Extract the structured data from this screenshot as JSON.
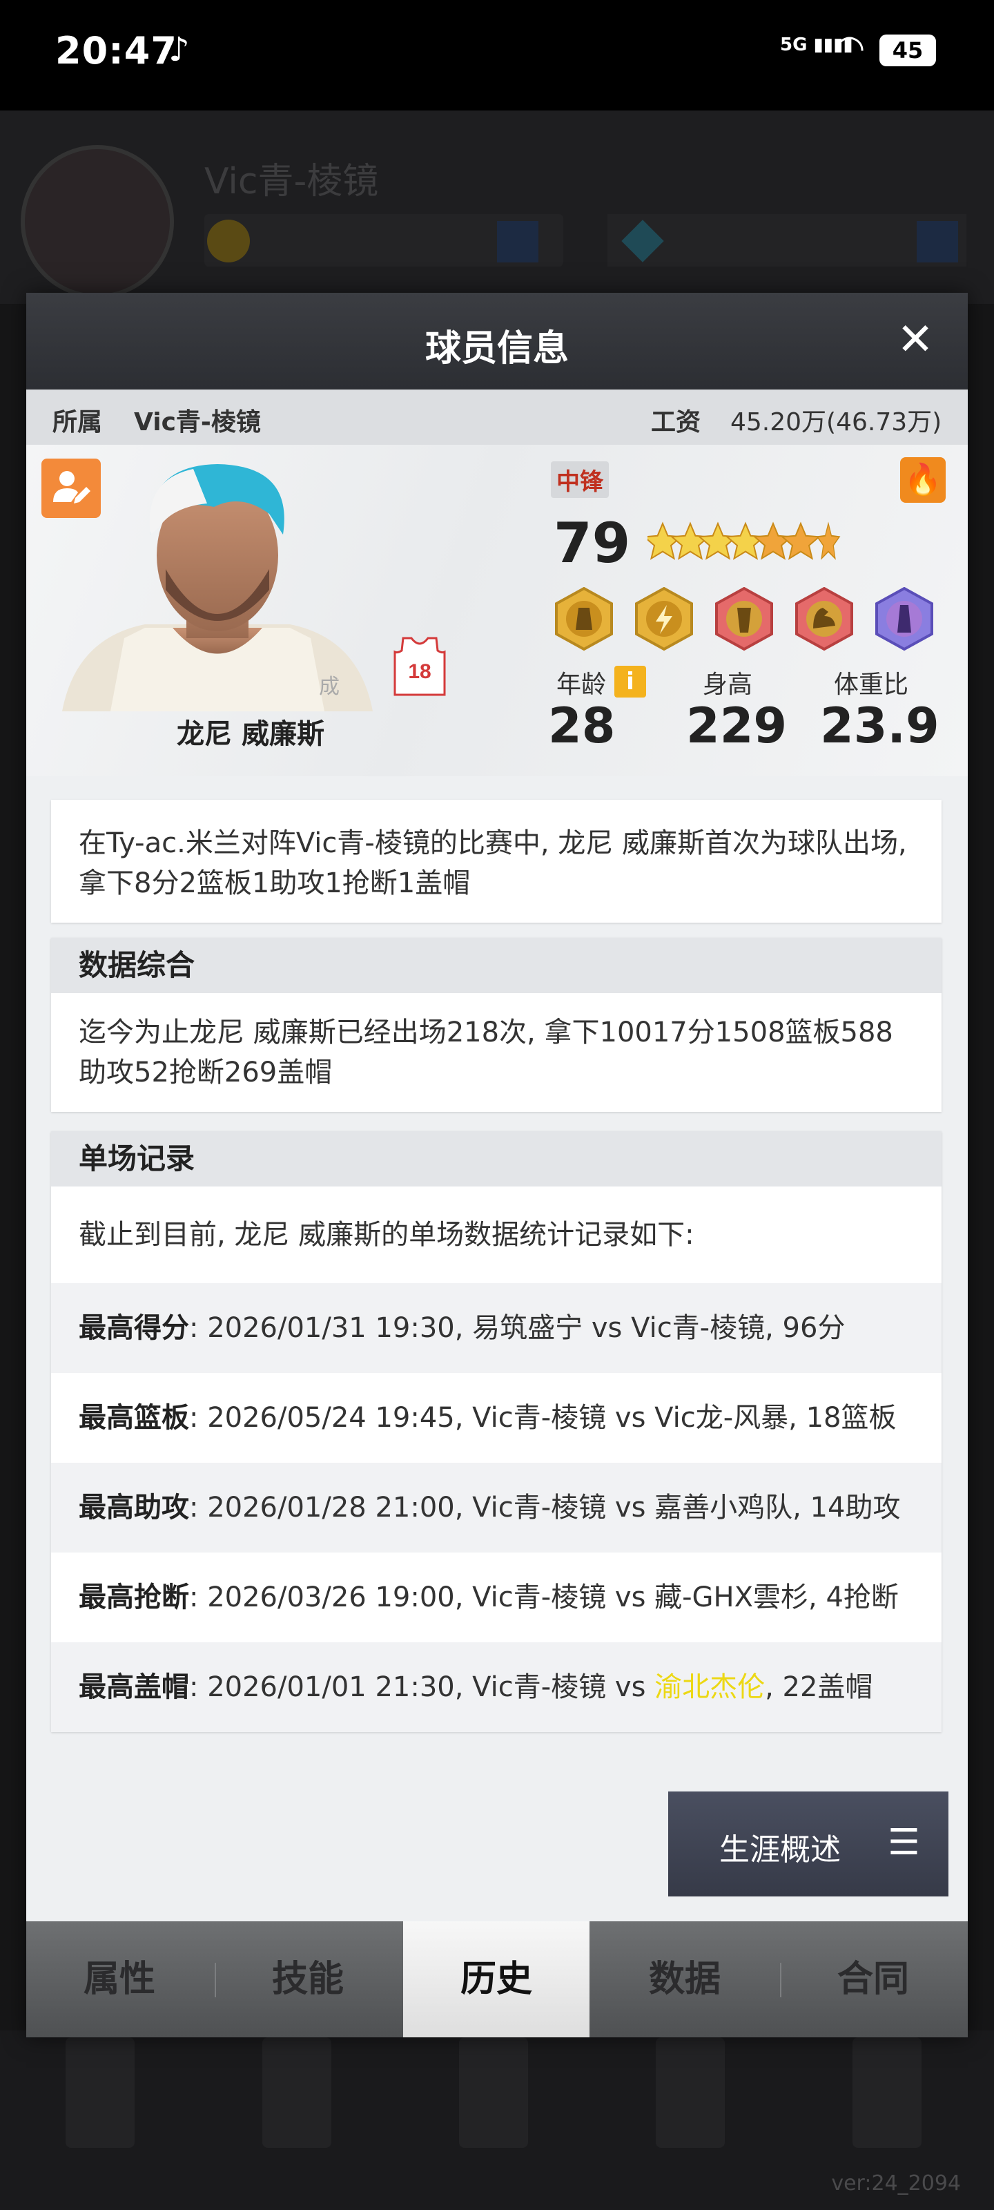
{
  "status_bar": {
    "time": "20:47",
    "network": "5G",
    "battery": "45"
  },
  "modal": {
    "title": "球员信息"
  },
  "affiliation": {
    "label": "所属",
    "team": "Vic青-棱镜"
  },
  "salary": {
    "label": "工资",
    "value": "45.20万(46.73万)"
  },
  "player": {
    "name": "龙尼 威廉斯",
    "position": "中锋",
    "jersey_number": "18",
    "portrait_badge": "成",
    "rating": "79",
    "star_rating": 6.5,
    "skill_icons": [
      "post-up-icon",
      "lightning-icon",
      "rebound-icon",
      "muscle-icon",
      "block-icon"
    ],
    "age_label": "年龄",
    "age": "28",
    "height_label": "身高",
    "height": "229",
    "weight_label": "体重比",
    "weight_ratio": "23.9"
  },
  "debut": {
    "text": "在Ty-ac.米兰对阵Vic青-棱镜的比赛中, 龙尼 威廉斯首次为球队出场, 拿下8分2篮板1助攻1抢断1盖帽"
  },
  "summary": {
    "title": "数据综合",
    "text": "迄今为止龙尼 威廉斯已经出场218次, 拿下10017分1508篮板588助攻52抢断269盖帽"
  },
  "records": {
    "title": "单场记录",
    "intro": "截止到目前, 龙尼 威廉斯的单场数据统计记录如下:",
    "rows": [
      {
        "label": "最高得分",
        "detail": ": 2026/01/31 19:30, 易筑盛宁 vs Vic青-棱镜, 96分"
      },
      {
        "label": "最高篮板",
        "detail": ": 2026/05/24 19:45, Vic青-棱镜 vs Vic龙-风暴, 18篮板"
      },
      {
        "label": "最高助攻",
        "detail": ": 2026/01/28 21:00, Vic青-棱镜 vs 嘉善小鸡队, 14助攻"
      },
      {
        "label": "最高抢断",
        "detail": ": 2026/03/26 19:00, Vic青-棱镜 vs 藏-GHX雲杉, 4抢断"
      },
      {
        "label": "最高盖帽",
        "detail_pre": ": 2026/01/01 21:30, Vic青-棱镜 vs ",
        "opponent": "渝北杰伦",
        "detail_post": ", 22盖帽"
      }
    ]
  },
  "career_button": {
    "label": "生涯概述"
  },
  "tabs": [
    {
      "label": "属性",
      "active": false
    },
    {
      "label": "技能",
      "active": false
    },
    {
      "label": "历史",
      "active": true
    },
    {
      "label": "数据",
      "active": false
    },
    {
      "label": "合同",
      "active": false
    }
  ],
  "version": "ver:24_2094",
  "colors": {
    "accent_orange": "#f38a3a",
    "position_red": "#c0301f",
    "highlight_yellow": "#ecd814",
    "modal_header": "#34363b"
  }
}
